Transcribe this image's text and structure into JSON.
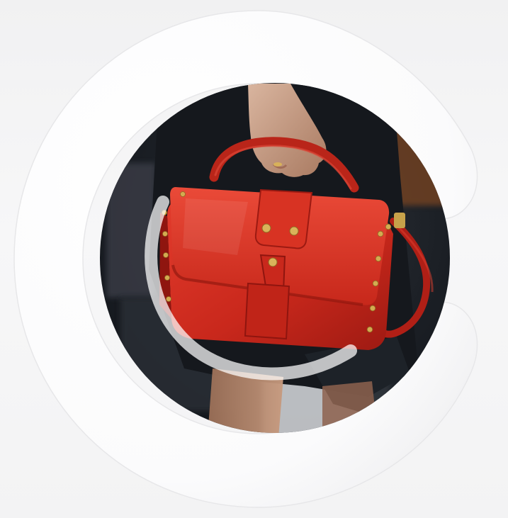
{
  "image": {
    "subject": "red-leather-handbag-in-circle",
    "brand_mark": "c-logo-ring",
    "colors": {
      "background": "#f2f2f3",
      "ring": "#ffffff",
      "bag_red": "#c9281c",
      "bag_shadow": "#8f150f",
      "studs": "#c9a24a",
      "dress": "#15181d"
    }
  }
}
